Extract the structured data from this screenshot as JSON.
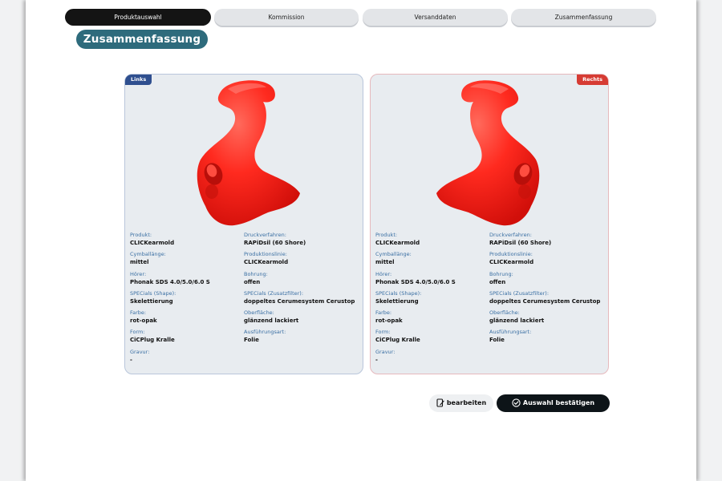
{
  "stepper": {
    "steps": [
      {
        "label": "Produktauswahl",
        "state": "active"
      },
      {
        "label": "Kommission",
        "state": "inactive"
      },
      {
        "label": "Versanddaten",
        "state": "inactive"
      },
      {
        "label": "Zusammenfassung",
        "state": "inactive"
      }
    ]
  },
  "page_title": "Zusammenfassung",
  "colors": {
    "accent": "#2e6b7c",
    "left_badge": "#2f4f8f",
    "right_badge": "#d63b33",
    "earmold": "#ff2a1f",
    "label": "#3a6fa3"
  },
  "cards": {
    "left": {
      "side": "Links",
      "image_icon": "red-earmold-left",
      "fields": {
        "produkt": {
          "label": "Produkt:",
          "value": "CLICKearmold"
        },
        "cymbal": {
          "label": "Cymballänge:",
          "value": "mittel"
        },
        "hoerer": {
          "label": "Hörer:",
          "value": "Phonak SDS 4.0/5.0/6.0 S"
        },
        "shape": {
          "label": "SPECials (Shape):",
          "value": "Skelettierung"
        },
        "farbe": {
          "label": "Farbe:",
          "value": "rot-opak"
        },
        "form": {
          "label": "Form:",
          "value": "CiCPlug Kralle"
        },
        "gravur": {
          "label": "Gravur:",
          "value": "-"
        },
        "druck": {
          "label": "Druckverfahren:",
          "value": "RAPiDsil (60 Shore)"
        },
        "linie": {
          "label": "Produktionslinie:",
          "value": "CLICKearmold"
        },
        "bohrung": {
          "label": "Bohrung:",
          "value": "offen"
        },
        "zusatz": {
          "label": "SPECials (Zusatzfilter):",
          "value": "doppeltes Cerumesystem Cerustop"
        },
        "oberflaeche": {
          "label": "Oberfläche:",
          "value": "glänzend lackiert"
        },
        "ausfuehrung": {
          "label": "Ausführungsart:",
          "value": "Folie"
        }
      }
    },
    "right": {
      "side": "Rechts",
      "image_icon": "red-earmold-right",
      "fields": {
        "produkt": {
          "label": "Produkt:",
          "value": "CLICKearmold"
        },
        "cymbal": {
          "label": "Cymballänge:",
          "value": "mittel"
        },
        "hoerer": {
          "label": "Hörer:",
          "value": "Phonak SDS 4.0/5.0/6.0 S"
        },
        "shape": {
          "label": "SPECials (Shape):",
          "value": "Skelettierung"
        },
        "farbe": {
          "label": "Farbe:",
          "value": "rot-opak"
        },
        "form": {
          "label": "Form:",
          "value": "CiCPlug Kralle"
        },
        "gravur": {
          "label": "Gravur:",
          "value": "-"
        },
        "druck": {
          "label": "Druckverfahren:",
          "value": "RAPiDsil (60 Shore)"
        },
        "linie": {
          "label": "Produktionslinie:",
          "value": "CLICKearmold"
        },
        "bohrung": {
          "label": "Bohrung:",
          "value": "offen"
        },
        "zusatz": {
          "label": "SPECials (Zusatzfilter):",
          "value": "doppeltes Cerumesystem Cerustop"
        },
        "oberflaeche": {
          "label": "Oberfläche:",
          "value": "glänzend lackiert"
        },
        "ausfuehrung": {
          "label": "Ausführungsart:",
          "value": "Folie"
        }
      }
    }
  },
  "actions": {
    "edit_label": "bearbeiten",
    "edit_icon": "edit-document-icon",
    "confirm_label": "Auswahl bestätigen",
    "confirm_icon": "check-circle-icon"
  }
}
